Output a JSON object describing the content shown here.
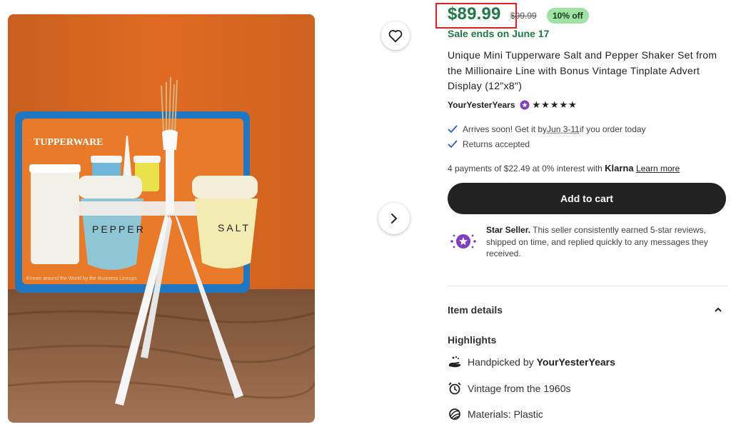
{
  "listing": {
    "price": "$89.99",
    "original_price": "$99.99",
    "discount_badge": "10% off",
    "sale_ends": "Sale ends on June 17",
    "title": "Unique Mini Tupperware Salt and Pepper Shaker Set from the Millionaire Line with Bonus Vintage Tinplate Advert Display (12\"x8\")",
    "shop_name": "YourYesterYears",
    "rating_stars": "★★★★★",
    "rating_value": 5
  },
  "delivery": {
    "arrives_prefix": "Arrives soon! Get it by ",
    "arrives_dates": "Jun 3-11",
    "arrives_suffix": " if you order today",
    "returns": "Returns accepted"
  },
  "payments": {
    "text": "4 payments of $22.49 at 0% interest with ",
    "provider": "Klarna",
    "learn_more": "Learn more"
  },
  "cart": {
    "label": "Add to cart"
  },
  "star_seller": {
    "title": "Star Seller.",
    "description": " This seller consistently earned 5-star reviews, shipped on time, and replied quickly to any messages they received."
  },
  "item_details": {
    "label": "Item details",
    "highlights_label": "Highlights",
    "handpicked_prefix": "Handpicked by",
    "handpicked_shop": "YourYesterYears",
    "vintage": "Vintage from the 1960s",
    "materials": "Materials: Plastic"
  },
  "photo": {
    "sign_brand": "TUPPERWARE",
    "shaker_left_text": "PEPPER",
    "shaker_right_text": "SALT",
    "sign_tagline": "Known around the World by the Business Lineups"
  },
  "icons": {
    "favorite": "heart-outline-icon",
    "next": "chevron-right-icon",
    "check": "checkmark-icon",
    "star_seller": "star-seller-badge-icon",
    "collapse": "chevron-up-icon",
    "handpicked": "hand-icon",
    "vintage": "alarm-clock-icon",
    "materials": "yarn-ball-icon"
  },
  "colors": {
    "price_green": "#1f7a45",
    "discount_bg": "#9ee2a4",
    "highlight_box": "#e02020",
    "star_seller_purple": "#7f3fbf",
    "check_blue": "#2f5fbd",
    "cart_bg": "#222222"
  }
}
